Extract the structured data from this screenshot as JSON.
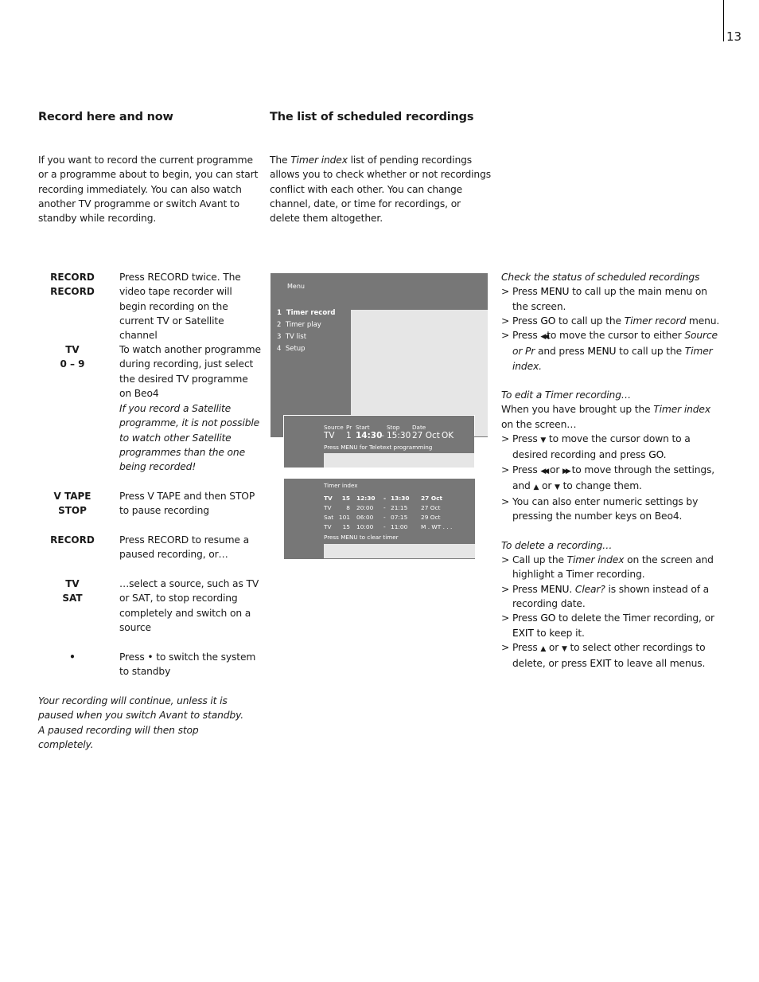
{
  "page_number": "13",
  "left": {
    "heading": "Record here and now",
    "intro": "If you want to record the current programme or a programme about to begin, you can start recording immediately. You can also watch another TV programme or switch Avant to standby while recording.",
    "steps": [
      {
        "keys": [
          "RECORD",
          "RECORD"
        ],
        "text": "Press RECORD twice. The video tape recorder will begin recording on the current TV or Satellite channel"
      },
      {
        "keys": [
          "TV",
          "0 – 9"
        ],
        "text": "To watch another programme during recording, just select the desired TV programme on Beo4"
      },
      {
        "keys": [],
        "text": "If you record a Satellite programme, it is not possible to watch other Satellite programmes than the one being recorded!",
        "italic": true
      },
      {
        "keys": [
          "V TAPE",
          "STOP"
        ],
        "text": "Press V TAPE and then STOP to pause recording"
      },
      {
        "keys": [
          "RECORD"
        ],
        "text": "Press RECORD to resume a paused recording, or…"
      },
      {
        "keys": [
          "TV",
          "SAT"
        ],
        "text": "…select a source, such as TV or SAT, to stop recording completely and switch on a source"
      },
      {
        "keys": [
          "•"
        ],
        "text": "Press • to switch the system to standby"
      }
    ],
    "footnote": "Your recording will continue, unless it is paused when you switch Avant to standby. A paused recording will then stop completely."
  },
  "middle": {
    "heading": "The list of scheduled recordings",
    "intro_pre": "The ",
    "intro_em": "Timer index",
    "intro_post": " list of pending recordings allows you to check whether or not recordings conflict with each other. You can change channel, date, or time for recordings, or delete them altogether."
  },
  "osd_menu": {
    "title": "Menu",
    "items": [
      {
        "num": "1",
        "label": "Timer record",
        "selected": true
      },
      {
        "num": "2",
        "label": "Timer play"
      },
      {
        "num": "3",
        "label": "TV list"
      },
      {
        "num": "4",
        "label": "Setup"
      }
    ]
  },
  "osd_timer_record": {
    "headers": {
      "source": "Source",
      "pr": "Pr",
      "start": "Start",
      "stop": "Stop",
      "date": "Date"
    },
    "values": {
      "source": "TV",
      "pr": "1",
      "start": "14:30",
      "sep": "-",
      "stop": "15:30",
      "date": "27 Oct",
      "ok": "OK"
    },
    "hint": "Press MENU for Teletext programming"
  },
  "osd_timer_index": {
    "title": "Timer index",
    "rows": [
      {
        "source": "TV",
        "pr": "15",
        "start": "12:30",
        "sep": "-",
        "stop": "13:30",
        "date": "27 Oct",
        "highlighted": true
      },
      {
        "source": "TV",
        "pr": "8",
        "start": "20:00",
        "sep": "-",
        "stop": "21:15",
        "date": "27 Oct"
      },
      {
        "source": "Sat",
        "pr": "101",
        "start": "06:00",
        "sep": "-",
        "stop": "07:15",
        "date": "29 Oct"
      },
      {
        "source": "TV",
        "pr": "15",
        "start": "10:00",
        "sep": "-",
        "stop": "11:00",
        "date": "M . WT . . ."
      }
    ],
    "hint": "Press MENU to clear timer"
  },
  "right": {
    "check_heading": "Check the status of scheduled recordings",
    "check_items": [
      [
        "Press ",
        {
          "b": "MENU"
        },
        " to call up the main menu on the screen."
      ],
      [
        "Press ",
        {
          "b": "GO"
        },
        " to call up the ",
        {
          "i": "Timer record"
        },
        " menu."
      ],
      [
        "Press ",
        {
          "icon": "rewind"
        },
        "to move the cursor to either ",
        {
          "i": "Source or Pr"
        },
        " and press ",
        {
          "b": "MENU"
        },
        " to call up the ",
        {
          "i": "Timer index."
        }
      ]
    ],
    "edit_heading": "To edit a Timer recording…",
    "edit_intro": [
      "When you have brought up the ",
      {
        "i": "Timer index"
      },
      " on the screen…"
    ],
    "edit_items": [
      [
        "Press ",
        {
          "icon": "down"
        },
        " to move the cursor down to a desired recording and press ",
        {
          "b": "GO"
        },
        "."
      ],
      [
        "Press ",
        {
          "icon": "rewind"
        },
        " or ",
        {
          "icon": "forward"
        },
        " to move through the settings, and ",
        {
          "icon": "up"
        },
        " or ",
        {
          "icon": "down"
        },
        " to change them."
      ],
      [
        "You can also enter numeric settings by pressing the number keys on Beo4."
      ]
    ],
    "delete_heading": "To delete a recording…",
    "delete_items": [
      [
        "Call up the ",
        {
          "i": "Timer index"
        },
        " on the screen and highlight a Timer recording."
      ],
      [
        "Press ",
        {
          "b": "MENU."
        },
        " ",
        {
          "i": "Clear?"
        },
        " is shown instead of a recording date."
      ],
      [
        "Press ",
        {
          "b": "GO"
        },
        " to delete the Timer recording, or ",
        {
          "b": "EXIT"
        },
        " to keep it."
      ],
      [
        "Press ",
        {
          "icon": "up"
        },
        " or ",
        {
          "icon": "down"
        },
        " to select other recordings to delete, or press ",
        {
          "b": "EXIT"
        },
        " to leave all menus."
      ]
    ],
    "bullet": ">"
  },
  "icons": {
    "rewind": "◀◀",
    "forward": "▶▶",
    "up": "▲",
    "down": "▼"
  }
}
